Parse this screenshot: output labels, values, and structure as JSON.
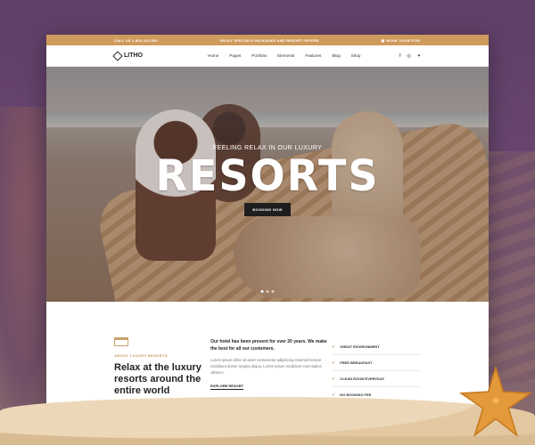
{
  "topbar": {
    "phone": "CALL US 1-800-222-000",
    "promo": "ENJOY SPECIALS PACKAGES AND RESORT OFFERS",
    "book": "BOOK YOUR STAY"
  },
  "nav": {
    "logo": "LITHO",
    "items": [
      {
        "label": "Home"
      },
      {
        "label": "Pages"
      },
      {
        "label": "Portfolio"
      },
      {
        "label": "Elements"
      },
      {
        "label": "Features"
      },
      {
        "label": "Blog"
      },
      {
        "label": "Shop"
      }
    ],
    "social": [
      "f",
      "◎",
      "✦"
    ]
  },
  "hero": {
    "subtitle": "FEELING RELAX IN OUR LUXURY",
    "title": "RESORTS",
    "button": "BOOKING NOW",
    "slide_count": 3,
    "active_slide": 1
  },
  "about": {
    "eyebrow": "ABOUT LUXURY RESORTS",
    "title": "Relax at the luxury resorts around the entire world",
    "lead": "Our hotel has been present for over 20 years. We make the best for all our customers.",
    "paragraph": "Lorem ipsum dolor sit amet consectetur adipiscing eiusmod tempor incididunt dolore magna aliqua. Lorem ipsum incididunt exercitation ullamco.",
    "link": "EXPLORE RESORT",
    "features": [
      {
        "label": "GREAT ENVIRONMENT"
      },
      {
        "label": "FREE BREAKFAST"
      },
      {
        "label": "CLEAN ROOM EVERYDAY"
      },
      {
        "label": "NO BOOKING FEE"
      }
    ]
  },
  "colors": {
    "accent": "#cf9b5c",
    "backdrop": "#5e3f66",
    "dark": "#1e1e1e"
  }
}
